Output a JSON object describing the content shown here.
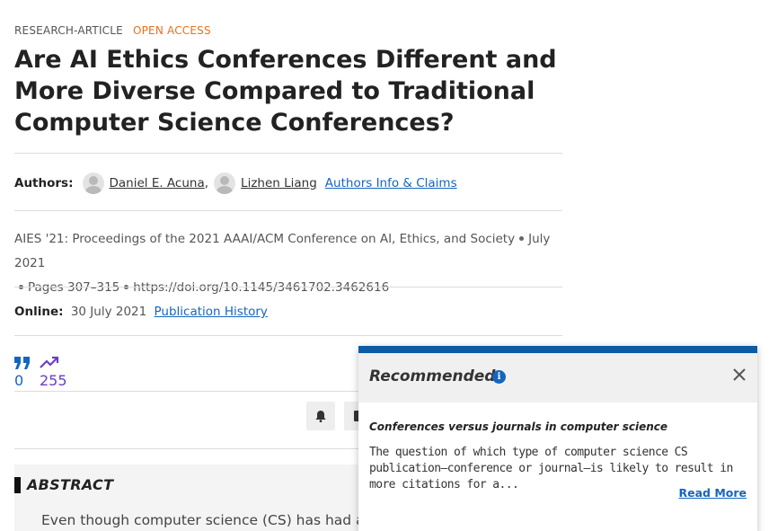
{
  "article": {
    "type": "RESEARCH-ARTICLE",
    "access": "OPEN ACCESS",
    "title": "Are AI Ethics Conferences Different and More Diverse Compared to Traditional Computer Science Conferences?"
  },
  "authors": {
    "label": "Authors:",
    "list": [
      {
        "name": "Daniel E. Acuna",
        "separator": ","
      },
      {
        "name": "Lizhen Liang",
        "separator": ""
      }
    ],
    "info_link": "Authors Info & Claims"
  },
  "venue": {
    "proceedings": "AIES '21: Proceedings of the 2021 AAAI/ACM Conference on AI, Ethics, and Society",
    "date": "July 2021",
    "pages": "Pages 307–315",
    "doi": "https://doi.org/10.1145/3461702.3462616"
  },
  "online": {
    "label": "Online:",
    "date": "30 July 2021",
    "history_link": "Publication History"
  },
  "metrics": {
    "citations": "0",
    "downloads": "255",
    "citation_icon": "quote-icon",
    "download_icon": "trending-up-icon"
  },
  "toolbar": {
    "buttons": [
      "bell-icon",
      "document-icon"
    ]
  },
  "abstract": {
    "heading": "ABSTRACT",
    "text": "Even though computer science (CS) has had a"
  },
  "recommended": {
    "title": "Recommended",
    "item_title": "Conferences versus journals in computer science",
    "item_text": "The question of which type of computer science CS publication–conference or journal–is likely to result in more citations for a...",
    "read_more": "Read More"
  },
  "colors": {
    "accent": "#1565c0",
    "open_access": "#e8701a",
    "downloads": "#6a3fc4",
    "panel_bar": "#0c5ba6"
  }
}
